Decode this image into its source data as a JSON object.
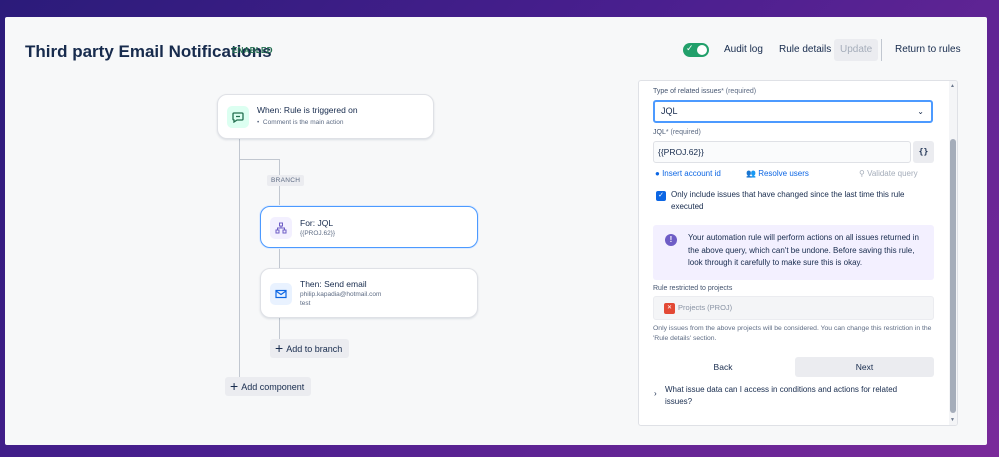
{
  "header": {
    "title": "Third party Email Notifications",
    "status": "ENABLED",
    "audit_log": "Audit log",
    "rule_details": "Rule details",
    "update": "Update",
    "return_to_rules": "Return to rules"
  },
  "canvas": {
    "trigger": {
      "title": "When: Rule is triggered on",
      "sub": "Comment is the main action"
    },
    "branch_tag": "BRANCH",
    "for_node": {
      "title": "For: JQL",
      "sub": "{{PROJ.62}}"
    },
    "then_node": {
      "title": "Then: Send email",
      "sub1": "philip.kapadia@hotmail.com",
      "sub2": "test"
    },
    "add_to_branch": "Add to branch",
    "add_component": "Add component"
  },
  "panel": {
    "type_label": "Type of related issues",
    "type_required": "* (required)",
    "type_value": "JQL",
    "jql_label": "JQL",
    "jql_required": "* (required)",
    "jql_value": "{{PROJ.62}}",
    "braces": "{}",
    "insert_account_id": "Insert account id",
    "resolve_users": "Resolve users",
    "validate_query": "Validate query",
    "checkbox_text": "Only include issues that have changed since the last time this rule executed",
    "warning": "Your automation rule will perform actions on all issues returned in the above query, which can't be undone. Before saving this rule, look through it carefully to make sure this is okay.",
    "restricted_label": "Rule restricted to projects",
    "projects_value": "Projects (PROJ)",
    "restriction_note": "Only issues from the above projects will be considered. You can change this restriction in the 'Rule details' section.",
    "back": "Back",
    "next": "Next",
    "faq": "What issue data can I access in conditions and actions for related issues?"
  },
  "colors": {
    "accent": "#0c66e4",
    "enabled": "#216e4e",
    "toggle": "#22a06b"
  }
}
